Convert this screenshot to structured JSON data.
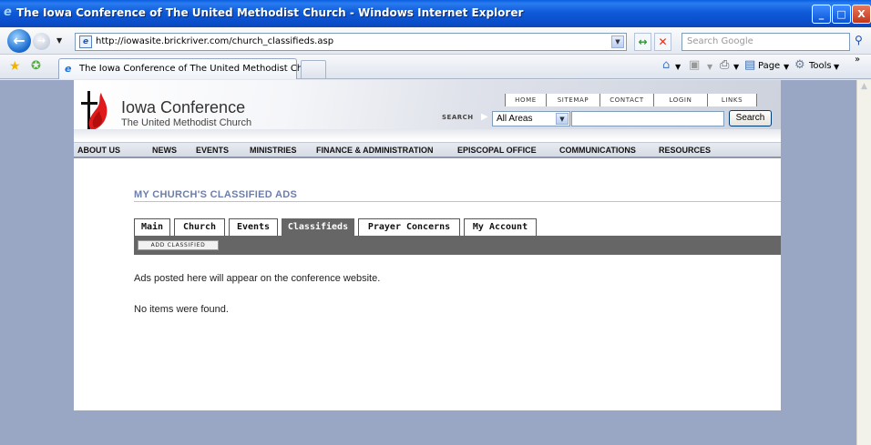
{
  "window": {
    "title": "The Iowa Conference of The United Methodist Church - Windows Internet Explorer",
    "minimize": "_",
    "maximize": "□",
    "close": "X"
  },
  "browser": {
    "address_url": "http://iowasite.brickriver.com/church_classifieds.asp",
    "search_placeholder": "Search Google",
    "tab_title": "The Iowa Conference of The United Methodist Church",
    "page_menu": "Page",
    "tools_menu": "Tools"
  },
  "site": {
    "org_name": "Iowa Conference",
    "org_subtitle": "The United Methodist Church",
    "util_links": [
      "HOME",
      "SITEMAP",
      "CONTACT",
      "LOGIN",
      "LINKS"
    ],
    "search_label": "SEARCH",
    "search_scope": "All Areas",
    "search_button": "Search",
    "main_nav": [
      "ABOUT US",
      "NEWS",
      "EVENTS",
      "MINISTRIES",
      "FINANCE & ADMINISTRATION",
      "EPISCOPAL OFFICE",
      "COMMUNICATIONS",
      "RESOURCES"
    ],
    "accent_color": "#6e7eaa"
  },
  "content": {
    "section_title": "MY CHURCH'S CLASSIFIED ADS",
    "tabs": [
      {
        "label": "Main",
        "active": false
      },
      {
        "label": "Church",
        "active": false
      },
      {
        "label": "Events",
        "active": false
      },
      {
        "label": "Classifieds",
        "active": true
      },
      {
        "label": "Prayer Concerns",
        "active": false
      },
      {
        "label": "My Account",
        "active": false
      }
    ],
    "add_button": "ADD CLASSIFIED",
    "info_text": "Ads posted here will appear on the conference website.",
    "empty_text": "No items were found."
  }
}
